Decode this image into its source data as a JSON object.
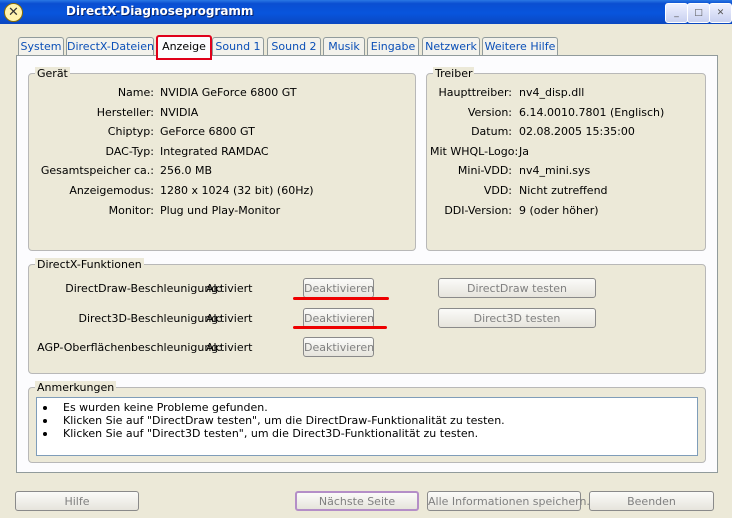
{
  "window": {
    "title": "DirectX-Diagnoseprogramm",
    "minimize": "_",
    "maximize": "□",
    "close": "✕"
  },
  "tabs": [
    {
      "label": "System"
    },
    {
      "label": "DirectX-Dateien"
    },
    {
      "label": "Anzeige"
    },
    {
      "label": "Sound 1"
    },
    {
      "label": "Sound 2"
    },
    {
      "label": "Musik"
    },
    {
      "label": "Eingabe"
    },
    {
      "label": "Netzwerk"
    },
    {
      "label": "Weitere Hilfe"
    }
  ],
  "device": {
    "title": "Gerät",
    "rows": [
      {
        "label": "Name:",
        "value": "NVIDIA GeForce 6800 GT"
      },
      {
        "label": "Hersteller:",
        "value": "NVIDIA"
      },
      {
        "label": "Chiptyp:",
        "value": "GeForce 6800 GT"
      },
      {
        "label": "DAC-Typ:",
        "value": "Integrated RAMDAC"
      },
      {
        "label": "Gesamtspeicher ca.:",
        "value": "256.0 MB"
      },
      {
        "label": "Anzeigemodus:",
        "value": "1280 x 1024 (32 bit) (60Hz)"
      },
      {
        "label": "Monitor:",
        "value": "Plug und Play-Monitor"
      }
    ]
  },
  "driver": {
    "title": "Treiber",
    "rows": [
      {
        "label": "Haupttreiber:",
        "value": "nv4_disp.dll"
      },
      {
        "label": "Version:",
        "value": "6.14.0010.7801 (Englisch)"
      },
      {
        "label": "Datum:",
        "value": "02.08.2005 15:35:00"
      },
      {
        "label": "Mit WHQL-Logo:",
        "value": "Ja"
      },
      {
        "label": "Mini-VDD:",
        "value": "nv4_mini.sys"
      },
      {
        "label": "VDD:",
        "value": "Nicht zutreffend"
      },
      {
        "label": "DDI-Version:",
        "value": "9 (oder höher)"
      }
    ]
  },
  "features": {
    "title": "DirectX-Funktionen",
    "rows": [
      {
        "label": "DirectDraw-Beschleunigung:",
        "status": "Aktiviert",
        "toggle": "Deaktivieren",
        "test": "DirectDraw testen"
      },
      {
        "label": "Direct3D-Beschleunigung:",
        "status": "Aktiviert",
        "toggle": "Deaktivieren",
        "test": "Direct3D testen"
      },
      {
        "label": "AGP-Oberflächenbeschleunigung:",
        "status": "Aktiviert",
        "toggle": "Deaktivieren"
      }
    ]
  },
  "notes": {
    "title": "Anmerkungen",
    "items": [
      "Es wurden keine Probleme gefunden.",
      "Klicken Sie auf \"DirectDraw testen\", um die DirectDraw-Funktionalität zu testen.",
      "Klicken Sie auf \"Direct3D testen\", um die Direct3D-Funktionalität zu testen."
    ]
  },
  "footer": {
    "help": "Hilfe",
    "next": "Nächste Seite",
    "save_all": "Alle Informationen speichern...",
    "exit": "Beenden"
  },
  "colors": {
    "titlebar": "#0855dd",
    "highlight": "#e00000",
    "tab_text": "#0b4fb7",
    "face": "#ece9d8"
  }
}
